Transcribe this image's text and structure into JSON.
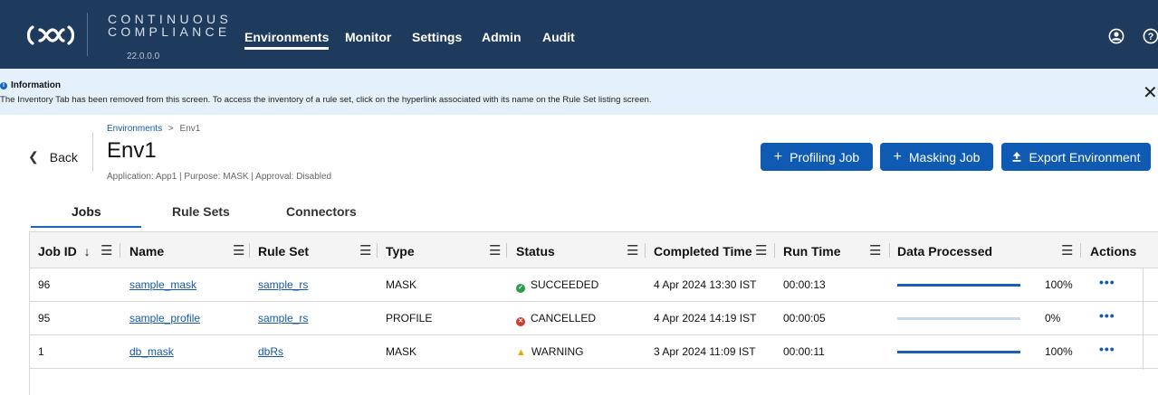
{
  "app": {
    "brand_line1": "CONTINUOUS",
    "brand_line2": "COMPLIANCE",
    "version": "22.0.0.0",
    "colors": {
      "nav_bg": "#1e3a5c",
      "accent": "#0f5bb3",
      "banner_bg": "#e4f1fc"
    }
  },
  "nav": [
    {
      "label": "Environments",
      "active": true
    },
    {
      "label": "Monitor"
    },
    {
      "label": "Settings"
    },
    {
      "label": "Admin"
    },
    {
      "label": "Audit"
    }
  ],
  "top_icons": [
    "user-icon",
    "help-icon"
  ],
  "banner": {
    "title": "Information",
    "text": "The Inventory Tab has been removed from this screen. To access the inventory of a rule set, click on the hyperlink associated with its name on the Rule Set listing screen.",
    "close": "✕"
  },
  "header": {
    "back": "Back",
    "breadcrumb_root": "Environments",
    "breadcrumb_sep": ">",
    "breadcrumb_current": "Env1",
    "title": "Env1",
    "subtitle": "Application: App1 | Purpose: MASK | Approval: Disabled"
  },
  "actions": {
    "profiling": "Profiling Job",
    "masking": "Masking Job",
    "export": "Export Environment"
  },
  "tabs": [
    "Jobs",
    "Rule Sets",
    "Connectors"
  ],
  "table": {
    "columns": [
      "Job ID",
      "Name",
      "Rule Set",
      "Type",
      "Status",
      "Completed Time",
      "Run Time",
      "Data Processed",
      "Actions"
    ],
    "sort_indicator": "↓",
    "rows": [
      {
        "id": "96",
        "name": "sample_mask",
        "rule_set": "sample_rs",
        "type": "MASK",
        "status": "SUCCEEDED",
        "status_kind": "success",
        "completed": "4 Apr 2024 13:30 IST",
        "run_time": "00:00:13",
        "progress": 100,
        "progress_label": "100%",
        "actions": "•••"
      },
      {
        "id": "95",
        "name": "sample_profile",
        "rule_set": "sample_rs",
        "type": "PROFILE",
        "status": "CANCELLED",
        "status_kind": "error",
        "completed": "4 Apr 2024 14:19 IST",
        "run_time": "00:00:05",
        "progress": 0,
        "progress_label": "0%",
        "actions": "•••"
      },
      {
        "id": "1",
        "name": "db_mask",
        "rule_set": "dbRs",
        "type": "MASK",
        "status": "WARNING",
        "status_kind": "warning",
        "completed": "3 Apr 2024 11:09 IST",
        "run_time": "00:00:11",
        "progress": 100,
        "progress_label": "100%",
        "actions": "•••"
      }
    ]
  }
}
